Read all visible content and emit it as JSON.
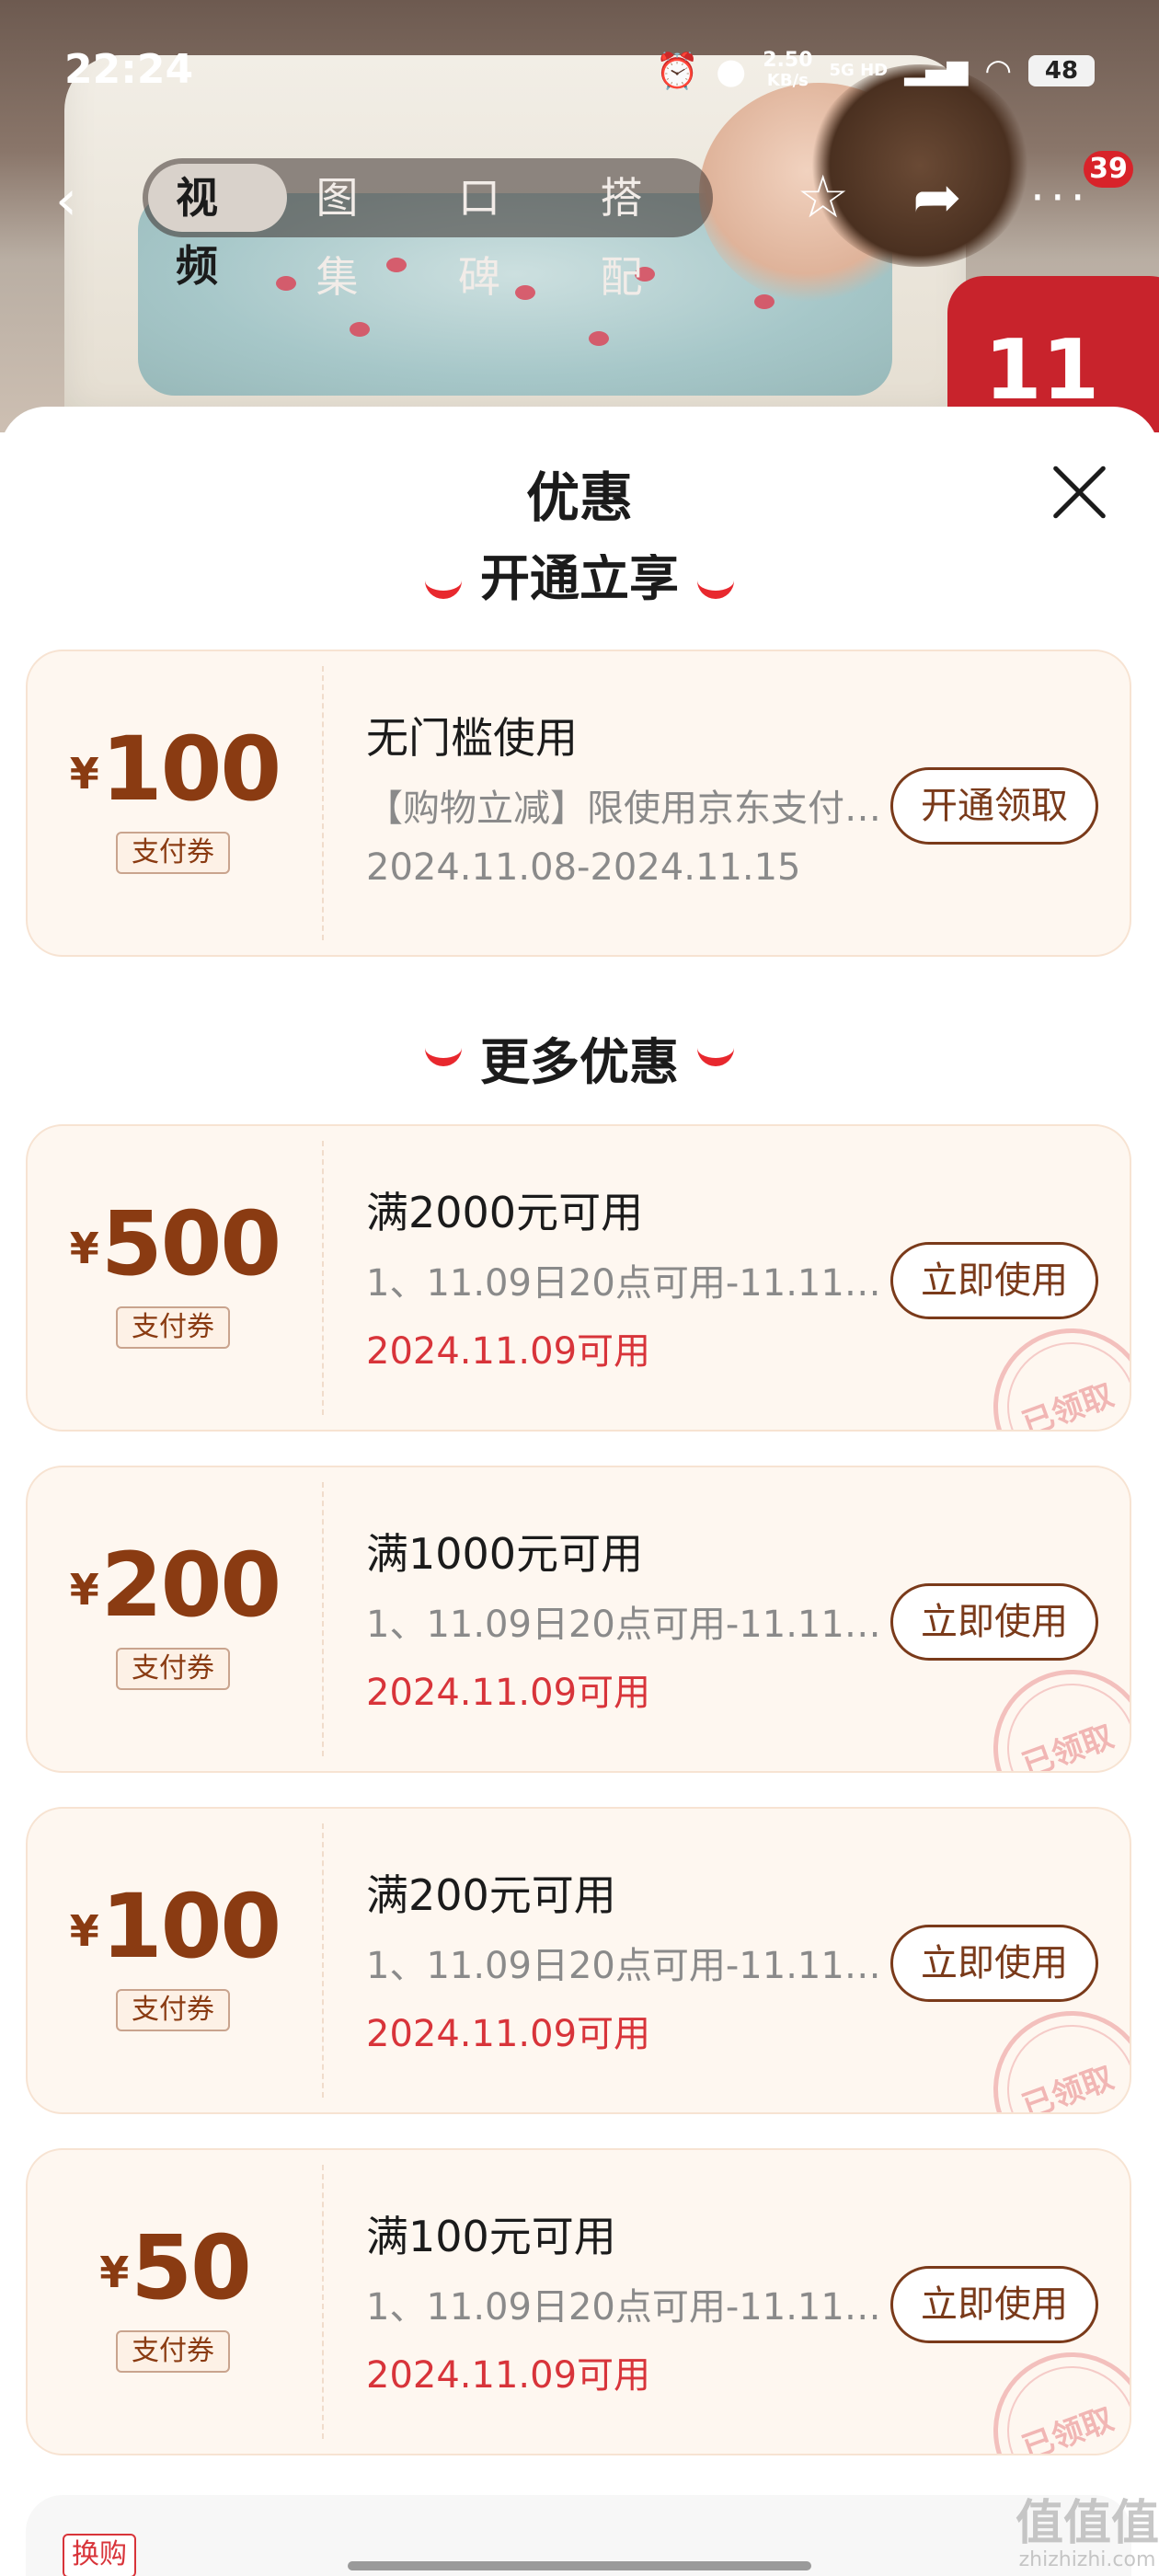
{
  "status_bar": {
    "time": "22:24",
    "net_speed_value": "2.50",
    "net_speed_unit": "KB/s",
    "signal_label": "5G HD",
    "battery": "48"
  },
  "nav": {
    "tabs": [
      {
        "label": "视频",
        "active": true
      },
      {
        "label": "图集",
        "active": false
      },
      {
        "label": "口碑",
        "active": false
      },
      {
        "label": "搭配",
        "active": false
      }
    ],
    "notification_count": "39",
    "hero_badge": "11"
  },
  "sheet": {
    "title": "优惠",
    "section_open": "开通立享",
    "section_more": "更多优惠"
  },
  "coupons": [
    {
      "currency": "¥",
      "amount": "100",
      "type": "支付券",
      "condition": "无门槛使用",
      "description": "【购物立减】限使用京东支付…",
      "date": "2024.11.08-2024.11.15",
      "date_highlight": false,
      "button": "开通领取",
      "claimed": false
    },
    {
      "currency": "¥",
      "amount": "500",
      "type": "支付券",
      "condition": "满2000元可用",
      "description": "1、11.09日20点可用-11.11…",
      "date": "2024.11.09可用",
      "date_highlight": true,
      "button": "立即使用",
      "claimed": true,
      "stamp": "已领取"
    },
    {
      "currency": "¥",
      "amount": "200",
      "type": "支付券",
      "condition": "满1000元可用",
      "description": "1、11.09日20点可用-11.11…",
      "date": "2024.11.09可用",
      "date_highlight": true,
      "button": "立即使用",
      "claimed": true,
      "stamp": "已领取"
    },
    {
      "currency": "¥",
      "amount": "100",
      "type": "支付券",
      "condition": "满200元可用",
      "description": "1、11.09日20点可用-11.11…",
      "date": "2024.11.09可用",
      "date_highlight": true,
      "button": "立即使用",
      "claimed": true,
      "stamp": "已领取"
    },
    {
      "currency": "¥",
      "amount": "50",
      "type": "支付券",
      "condition": "满100元可用",
      "description": "1、11.09日20点可用-11.11…",
      "date": "2024.11.09可用",
      "date_highlight": true,
      "button": "立即使用",
      "claimed": true,
      "stamp": "已领取"
    }
  ],
  "bottom_card": {
    "tag": "换购"
  },
  "watermark": {
    "logo": "值值值",
    "site": "zhizhizhi.com"
  },
  "colors": {
    "accent_red": "#d8343a",
    "coupon_brown": "#8a3b12",
    "coupon_bg": "#fef7f0"
  }
}
